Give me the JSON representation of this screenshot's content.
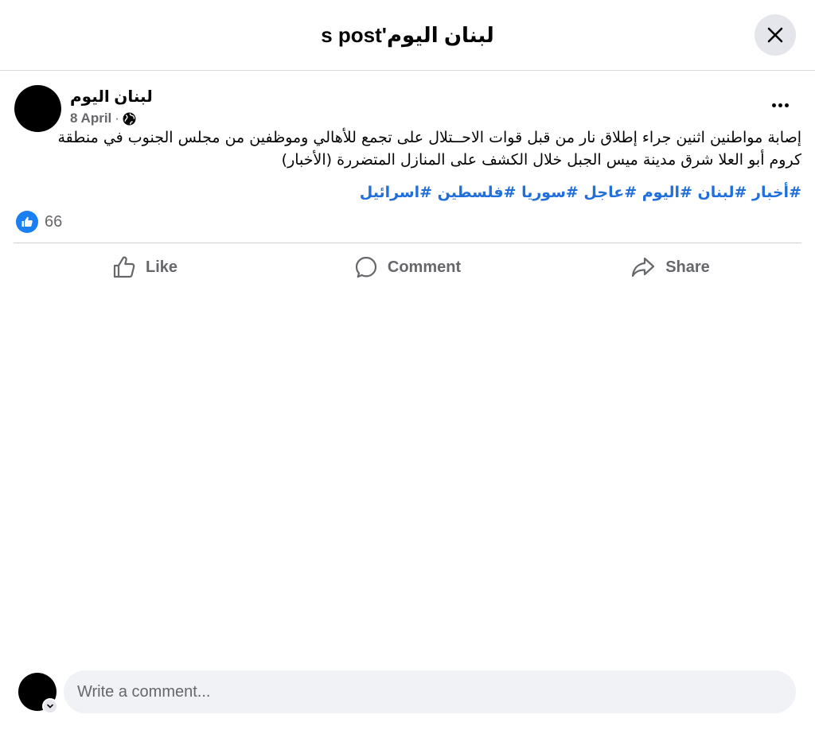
{
  "header": {
    "title": "لبنان اليوم's post",
    "close_icon": "close-icon"
  },
  "post": {
    "author": "لبنان اليوم",
    "date": "8 April",
    "separator": "·",
    "privacy_icon": "globe-icon",
    "more_icon": "more-options-icon",
    "text": "إصابة مواطنين اثنين جراء إطلاق نار من قبل قوات الاحــتلال على تجمع للأهالي وموظفين من مجلس الجنوب في منطقة كروم أبو العلا شرق مدينة ميس الجبل خلال الكشف على المنازل المتضررة (الأخبار)",
    "hashtags": "#أخبار #لبنان #اليوم #عاجل #سوريا #فلسطين #اسرائيل",
    "reaction_icon": "like-reaction-icon",
    "reaction_count": "66"
  },
  "actions": {
    "like_label": "Like",
    "comment_label": "Comment",
    "share_label": "Share"
  },
  "comment_box": {
    "placeholder": "Write a comment..."
  },
  "colors": {
    "accent": "#216fdb",
    "like_blue": "#1a7ff0",
    "muted": "#65676b",
    "input_bg": "#f0f2f5"
  }
}
